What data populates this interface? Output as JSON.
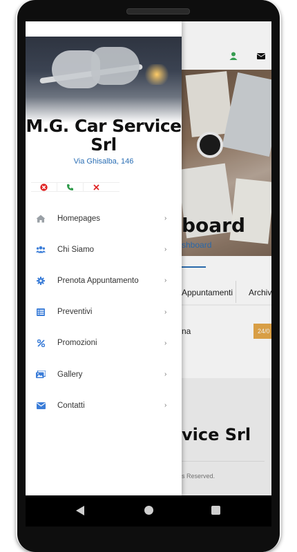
{
  "background_app": {
    "page_title": "board",
    "breadcrumb": "shboard",
    "tabs": [
      "Appuntamenti",
      "Archiv"
    ],
    "row_text": "na",
    "badge": "24/0",
    "footer_title": "vice Srl",
    "rights": "s Reserved."
  },
  "drawer": {
    "title": "M.G. Car Service Srl",
    "address": "Via Ghisalba, 146",
    "contact_icons": [
      "close-circle-icon",
      "phone-icon",
      "close-icon"
    ],
    "menu": [
      {
        "label": "Homepages",
        "icon": "home-icon"
      },
      {
        "label": "Chi Siamo",
        "icon": "users-icon"
      },
      {
        "label": "Prenota Appuntamento",
        "icon": "gear-icon"
      },
      {
        "label": "Preventivi",
        "icon": "list-icon"
      },
      {
        "label": "Promozioni",
        "icon": "percent-icon"
      },
      {
        "label": "Gallery",
        "icon": "images-icon"
      },
      {
        "label": "Contatti",
        "icon": "envelope-icon"
      }
    ],
    "chevron": "›"
  },
  "colors": {
    "accent": "#2b6fb5",
    "icon": "#3b7dd8",
    "badge": "#e6a84a",
    "phone_green": "#2e9a4a",
    "red": "#e02424"
  }
}
